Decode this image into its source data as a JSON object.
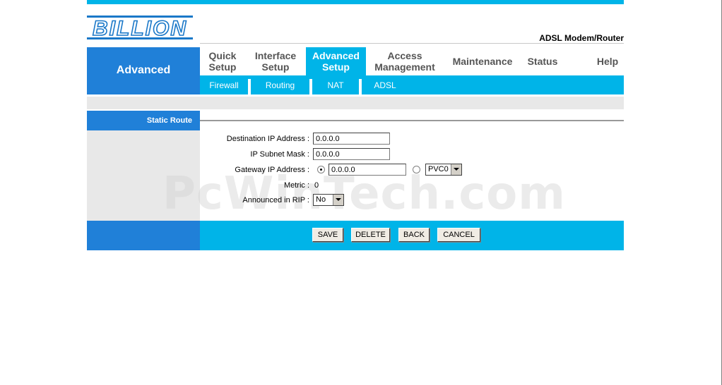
{
  "brand": {
    "logo_text": "BILLION",
    "product": "ADSL Modem/Router",
    "logo_color": "#1a78c8"
  },
  "sidebar": {
    "title": "Advanced",
    "section_title": "Static Route"
  },
  "nav": [
    {
      "line1": "Quick",
      "line2": "Setup"
    },
    {
      "line1": "Interface",
      "line2": "Setup"
    },
    {
      "line1": "Advanced",
      "line2": "Setup"
    },
    {
      "line1": "Access",
      "line2": "Management"
    },
    {
      "line1": "Maintenance",
      "line2": ""
    },
    {
      "line1": "Status",
      "line2": ""
    },
    {
      "line1": "Help",
      "line2": ""
    }
  ],
  "subnav": [
    "Firewall",
    "Routing",
    "NAT",
    "ADSL"
  ],
  "form": {
    "dest_ip_label": "Destination IP Address :",
    "dest_ip_value": "0.0.0.0",
    "subnet_label": "IP Subnet Mask :",
    "subnet_value": "0.0.0.0",
    "gateway_label": "Gateway IP Address :",
    "gateway_value": "0.0.0.0",
    "pvc_value": "PVC0",
    "metric_label": "Metric :",
    "metric_value": "0",
    "rip_label": "Announced in RIP :",
    "rip_value": "No"
  },
  "buttons": {
    "save": "SAVE",
    "delete": "DELETE",
    "back": "BACK",
    "cancel": "CANCEL"
  },
  "watermark": "PcWinTech.com",
  "colors": {
    "primary_blue": "#2080d8",
    "cyan": "#00b4e8",
    "grey": "#e8e8e8"
  }
}
